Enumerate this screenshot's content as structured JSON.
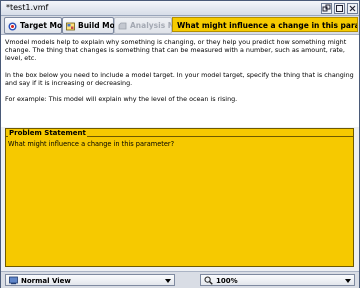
{
  "window": {
    "title": "*test1.vmf",
    "controls": {
      "restore_icon": "restore-icon",
      "maximize_icon": "maximize-icon",
      "close_icon": "close-icon"
    }
  },
  "toolbar": {
    "modes": [
      {
        "label": "Target Mode",
        "icon": "target-icon",
        "enabled": true
      },
      {
        "label": "Build Mode",
        "icon": "build-icon",
        "enabled": true
      },
      {
        "label": "Analysis Mode",
        "icon": "analysis-icon",
        "enabled": false
      }
    ],
    "question": "What might influence a change in this parameter?"
  },
  "instructions": {
    "paragraphs": [
      "Vmodel models help to explain why something is changing, or they help you predict how something might change. The thing that changes is something that can be measured with a number, such as amount, rate, level, etc.",
      "In the box below you need to include a model target. In your model target, specify the thing that is changing and say if it is increasing or decreasing.",
      "For example: This model will explain why the level of the ocean is rising."
    ]
  },
  "problem_statement": {
    "legend": "Problem Statement",
    "content": "What might influence a change in this parameter?"
  },
  "statusbar": {
    "view": {
      "label": "Normal View",
      "icon": "view-icon"
    },
    "zoom": {
      "label": "100%",
      "icon": "zoom-icon"
    }
  },
  "colors": {
    "accent_yellow": "#f6c900",
    "frame_border": "#4a5a78",
    "toolbar_bg": "#d9dde5"
  }
}
